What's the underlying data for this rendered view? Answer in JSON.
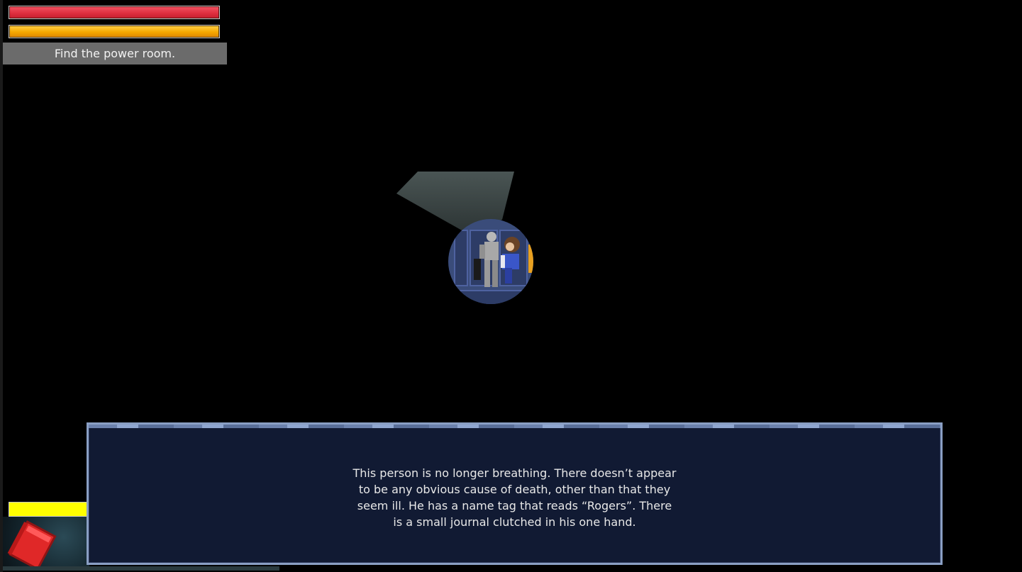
{
  "hud": {
    "health": 1.0,
    "stamina": 1.0,
    "objective": "Find the power room.",
    "item_bar": 1.0,
    "item_name": "journal-icon"
  },
  "dialog": {
    "text": "This person is no longer breathing. There doesn’t appear to be any obvious cause of death, other than that they seem ill. He has a name tag that reads “Rogers”. There is a small journal clutched in his one hand."
  },
  "colors": {
    "health": "#e03040",
    "stamina": "#f5a800",
    "item_bar": "#ffff00",
    "dialog_bg": "#111a33",
    "dialog_border": "#8a9fc4"
  }
}
